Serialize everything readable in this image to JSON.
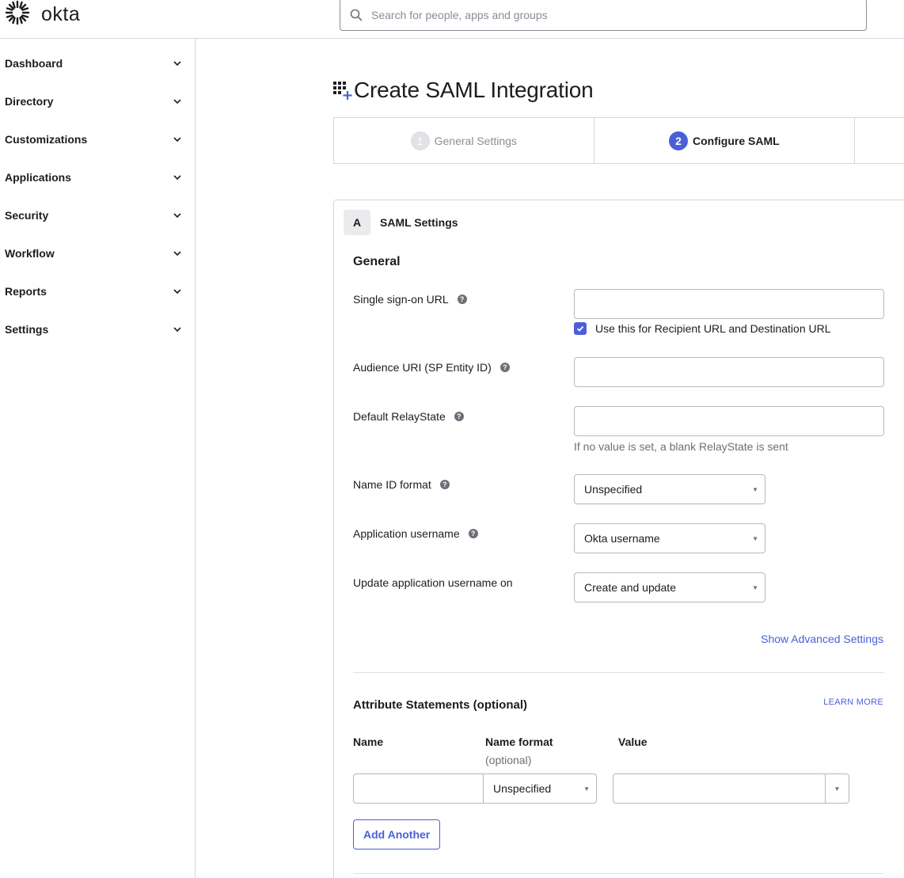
{
  "header": {
    "logo_text": "okta",
    "search_placeholder": "Search for people, apps and groups"
  },
  "sidebar": {
    "items": [
      {
        "label": "Dashboard"
      },
      {
        "label": "Directory"
      },
      {
        "label": "Customizations"
      },
      {
        "label": "Applications"
      },
      {
        "label": "Security"
      },
      {
        "label": "Workflow"
      },
      {
        "label": "Reports"
      },
      {
        "label": "Settings"
      }
    ]
  },
  "page": {
    "title": "Create SAML Integration"
  },
  "stepper": {
    "steps": [
      {
        "number": "1",
        "label": "General Settings",
        "state": "completed"
      },
      {
        "number": "2",
        "label": "Configure SAML",
        "state": "active"
      }
    ]
  },
  "panel": {
    "letter": "A",
    "title": "SAML Settings",
    "general_heading": "General",
    "fields": {
      "sso_url": {
        "label": "Single sign-on URL",
        "value": ""
      },
      "recipient_checkbox": {
        "label": "Use this for Recipient URL and Destination URL",
        "checked": true
      },
      "audience_uri": {
        "label": "Audience URI (SP Entity ID)",
        "value": ""
      },
      "relay_state": {
        "label": "Default RelayState",
        "value": "",
        "hint": "If no value is set, a blank RelayState is sent"
      },
      "name_id_format": {
        "label": "Name ID format",
        "selected": "Unspecified"
      },
      "app_username": {
        "label": "Application username",
        "selected": "Okta username"
      },
      "update_username_on": {
        "label": "Update application username on",
        "selected": "Create and update"
      }
    },
    "advanced_link": "Show Advanced Settings",
    "attributes": {
      "heading": "Attribute Statements (optional)",
      "learn_more": "LEARN MORE",
      "columns": {
        "name": "Name",
        "name_format": "Name format",
        "name_format_sub": "(optional)",
        "value": "Value"
      },
      "row": {
        "name": "",
        "name_format": "Unspecified",
        "value": ""
      },
      "add_button": "Add Another"
    }
  },
  "colors": {
    "accent": "#4b5fd9",
    "border": "#d7d7dc",
    "text": "#1d1d21",
    "muted": "#6e6e78"
  }
}
